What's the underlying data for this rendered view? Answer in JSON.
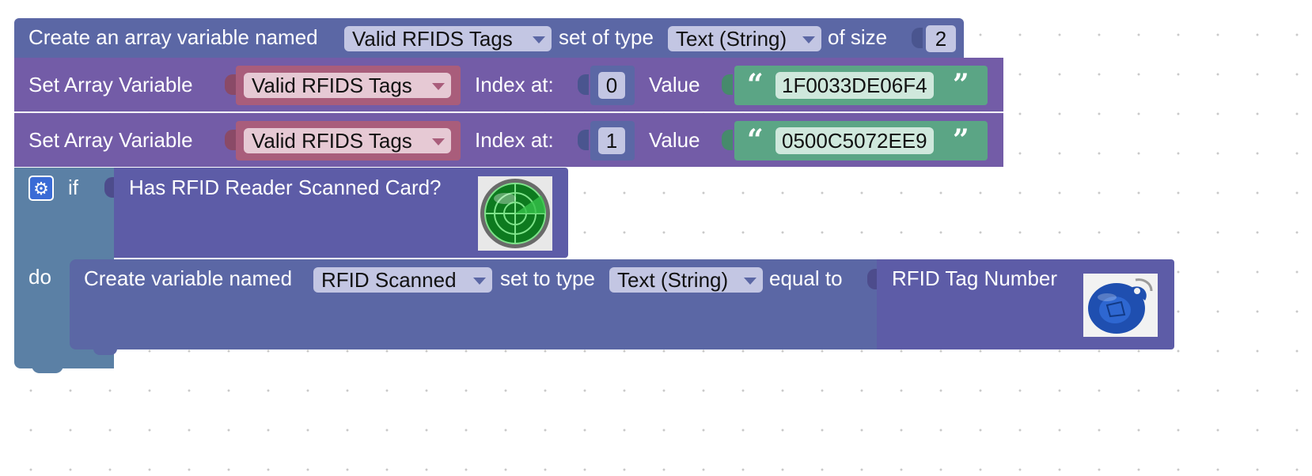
{
  "colors": {
    "create_block": "#5b67a5",
    "array_block": "#735ca7",
    "var_pill": "#a95d7b",
    "string_block": "#5ba585",
    "if_block": "#5b80a5",
    "sensor_block": "#5d5ca7"
  },
  "create_array": {
    "prefix": "Create an array variable named",
    "var_name": "Valid RFIDS Tags",
    "type_label": "set of type",
    "type_value": "Text (String)",
    "size_label": "of size",
    "size_value": "2"
  },
  "set_rows": [
    {
      "label": "Set Array Variable",
      "var_name": "Valid RFIDS Tags",
      "index_label": "Index at:",
      "index": "0",
      "value_label": "Value",
      "value": "1F0033DE06F4"
    },
    {
      "label": "Set Array Variable",
      "var_name": "Valid RFIDS Tags",
      "index_label": "Index at:",
      "index": "1",
      "value_label": "Value",
      "value": "0500C5072EE9"
    }
  ],
  "if_block": {
    "if_label": "if",
    "do_label": "do",
    "condition": "Has RFID Reader Scanned Card?",
    "condition_icon": "radar-icon"
  },
  "create_var": {
    "prefix": "Create variable named",
    "var_name": "RFID Scanned",
    "type_label": "set to type",
    "type_value": "Text (String)",
    "equal_label": "equal to",
    "value_block": "RFID Tag Number",
    "value_icon": "rfid-keyfob-icon"
  },
  "quote_open": "“",
  "quote_close": "”"
}
